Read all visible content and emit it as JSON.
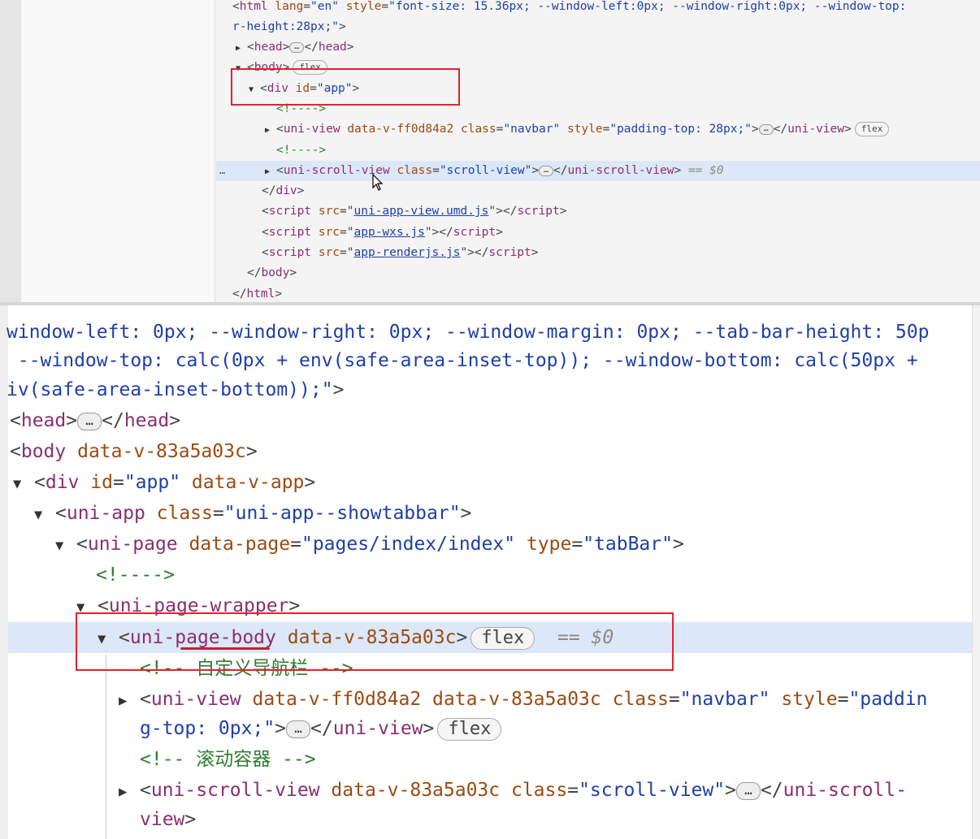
{
  "top_panel": {
    "lines": [
      {
        "parts": [
          [
            "p",
            "<"
          ],
          [
            "t",
            "html "
          ],
          [
            "a",
            "lang"
          ],
          [
            "p",
            "="
          ],
          [
            "v",
            "\"en\""
          ],
          [
            "p",
            " "
          ],
          [
            "a",
            "style"
          ],
          [
            "p",
            "="
          ],
          [
            "v",
            "\"font-size: 15.36px; --window-left:0px; --window-right:0px; --window-top:"
          ]
        ]
      },
      {
        "parts": [
          [
            "v",
            "r-height:28px;\""
          ],
          [
            "p",
            ">"
          ]
        ]
      },
      {
        "tri": "▶",
        "parts": [
          [
            "p",
            "<"
          ],
          [
            "t",
            "head"
          ],
          [
            "p",
            ">"
          ],
          [
            "d",
            "…"
          ],
          [
            "p",
            "</"
          ],
          [
            "t",
            "head"
          ],
          [
            "p",
            ">"
          ]
        ]
      },
      {
        "tri": "▼",
        "parts": [
          [
            "p",
            "<"
          ],
          [
            "t",
            "body"
          ],
          [
            "p",
            ">"
          ],
          [
            "b",
            "flex"
          ]
        ]
      },
      {
        "tri": "▼",
        "parts": [
          [
            "p",
            "<"
          ],
          [
            "t",
            "div "
          ],
          [
            "a",
            "id"
          ],
          [
            "p",
            "="
          ],
          [
            "v",
            "\"app\""
          ],
          [
            "p",
            ">"
          ]
        ]
      },
      {
        "parts": [
          [
            "c",
            "<!---->"
          ]
        ]
      },
      {
        "tri": "▶",
        "parts": [
          [
            "p",
            "<"
          ],
          [
            "t",
            "uni-view "
          ],
          [
            "a",
            "data-v-ff0d84a2 class"
          ],
          [
            "p",
            "="
          ],
          [
            "v",
            "\"navbar\""
          ],
          [
            "p",
            " "
          ],
          [
            "a",
            "style"
          ],
          [
            "p",
            "="
          ],
          [
            "v",
            "\"padding-top: 28px;\""
          ],
          [
            "p",
            ">"
          ],
          [
            "d",
            "…"
          ],
          [
            "p",
            "</"
          ],
          [
            "t",
            "uni-view"
          ],
          [
            "p",
            ">"
          ],
          [
            "b",
            "flex"
          ]
        ]
      },
      {
        "parts": [
          [
            "c",
            "<!---->"
          ]
        ]
      },
      {
        "tri": "▶",
        "parts": [
          [
            "p",
            "<"
          ],
          [
            "t",
            "uni-scroll-view "
          ],
          [
            "a",
            "class"
          ],
          [
            "p",
            "="
          ],
          [
            "v",
            "\"scroll-view\""
          ],
          [
            "p",
            ">"
          ],
          [
            "d",
            "…"
          ],
          [
            "p",
            "</"
          ],
          [
            "t",
            "uni-scroll-view"
          ],
          [
            "p",
            "> "
          ],
          [
            "e",
            "== $0"
          ]
        ]
      },
      {
        "parts": [
          [
            "p",
            "</"
          ],
          [
            "t",
            "div"
          ],
          [
            "p",
            ">"
          ]
        ]
      },
      {
        "parts": [
          [
            "p",
            "<"
          ],
          [
            "t",
            "script "
          ],
          [
            "a",
            "src"
          ],
          [
            "p",
            "=\""
          ],
          [
            "l",
            "uni-app-view.umd.js"
          ],
          [
            "p",
            "\"></"
          ],
          [
            "t",
            "script"
          ],
          [
            "p",
            ">"
          ]
        ]
      },
      {
        "parts": [
          [
            "p",
            "<"
          ],
          [
            "t",
            "script "
          ],
          [
            "a",
            "src"
          ],
          [
            "p",
            "=\""
          ],
          [
            "l",
            "app-wxs.js"
          ],
          [
            "p",
            "\"></"
          ],
          [
            "t",
            "script"
          ],
          [
            "p",
            ">"
          ]
        ]
      },
      {
        "parts": [
          [
            "p",
            "<"
          ],
          [
            "t",
            "script "
          ],
          [
            "a",
            "src"
          ],
          [
            "p",
            "=\""
          ],
          [
            "l",
            "app-renderjs.js"
          ],
          [
            "p",
            "\"></"
          ],
          [
            "t",
            "script"
          ],
          [
            "p",
            ">"
          ]
        ]
      },
      {
        "parts": [
          [
            "p",
            "</"
          ],
          [
            "t",
            "body"
          ],
          [
            "p",
            ">"
          ]
        ]
      },
      {
        "parts": [
          [
            "p",
            "</"
          ],
          [
            "t",
            "html"
          ],
          [
            "p",
            ">"
          ]
        ]
      }
    ]
  },
  "bottom_panel": {
    "lines": [
      {
        "parts": [
          [
            "v",
            "window-left: 0px; --window-right: 0px; --window-margin: 0px; --tab-bar-height: 50p"
          ]
        ]
      },
      {
        "parts": [
          [
            "v",
            " --window-top: calc(0px + env(safe-area-inset-top)); --window-bottom: calc(50px +"
          ]
        ]
      },
      {
        "parts": [
          [
            "v",
            "iv(safe-area-inset-bottom));\""
          ],
          [
            "p",
            ">"
          ]
        ]
      },
      {
        "parts": [
          [
            "p",
            "<"
          ],
          [
            "t",
            "head"
          ],
          [
            "p",
            ">"
          ],
          [
            "d",
            "…"
          ],
          [
            "p",
            "</"
          ],
          [
            "t",
            "head"
          ],
          [
            "p",
            ">"
          ]
        ]
      },
      {
        "parts": [
          [
            "p",
            "<"
          ],
          [
            "t",
            "body "
          ],
          [
            "a",
            "data-v-83a5a03c"
          ],
          [
            "p",
            ">"
          ]
        ]
      },
      {
        "tri": "▼",
        "parts": [
          [
            "p",
            "<"
          ],
          [
            "t",
            "div "
          ],
          [
            "a",
            "id"
          ],
          [
            "p",
            "="
          ],
          [
            "v",
            "\"app\""
          ],
          [
            "p",
            " "
          ],
          [
            "a",
            "data-v-app"
          ],
          [
            "p",
            ">"
          ]
        ]
      },
      {
        "tri": "▼",
        "parts": [
          [
            "p",
            "<"
          ],
          [
            "t",
            "uni-app "
          ],
          [
            "a",
            "class"
          ],
          [
            "p",
            "="
          ],
          [
            "v",
            "\"uni-app--showtabbar\""
          ],
          [
            "p",
            ">"
          ]
        ]
      },
      {
        "tri": "▼",
        "parts": [
          [
            "p",
            "<"
          ],
          [
            "t",
            "uni-page "
          ],
          [
            "a",
            "data-page"
          ],
          [
            "p",
            "="
          ],
          [
            "v",
            "\"pages/index/index\""
          ],
          [
            "p",
            " "
          ],
          [
            "a",
            "type"
          ],
          [
            "p",
            "="
          ],
          [
            "v",
            "\"tabBar\""
          ],
          [
            "p",
            ">"
          ]
        ]
      },
      {
        "parts": [
          [
            "c",
            "<!---->"
          ]
        ]
      },
      {
        "tri": "▼",
        "parts": [
          [
            "p",
            "<"
          ],
          [
            "t",
            "uni-page-wrapper"
          ],
          [
            "p",
            ">"
          ]
        ]
      },
      {
        "tri": "▼",
        "parts": [
          [
            "p",
            "<"
          ],
          [
            "t",
            "uni-page-body "
          ],
          [
            "a",
            "data-v-83a5a03c"
          ],
          [
            "p",
            ">"
          ],
          [
            "b",
            "flex"
          ],
          [
            "p",
            "  "
          ],
          [
            "e",
            "== $0"
          ]
        ]
      },
      {
        "parts": [
          [
            "c",
            "<!-- 自定义导航栏 -->"
          ]
        ]
      },
      {
        "tri": "▶",
        "parts": [
          [
            "p",
            "<"
          ],
          [
            "t",
            "uni-view "
          ],
          [
            "a",
            "data-v-ff0d84a2 data-v-83a5a03c class"
          ],
          [
            "p",
            "="
          ],
          [
            "v",
            "\"navbar\""
          ],
          [
            "p",
            " "
          ],
          [
            "a",
            "style"
          ],
          [
            "p",
            "="
          ],
          [
            "v",
            "\"paddin"
          ]
        ]
      },
      {
        "parts": [
          [
            "v",
            "g-top: 0px;\""
          ],
          [
            "p",
            ">"
          ],
          [
            "d",
            "…"
          ],
          [
            "p",
            "</"
          ],
          [
            "t",
            "uni-view"
          ],
          [
            "p",
            ">"
          ],
          [
            "b",
            "flex"
          ]
        ]
      },
      {
        "parts": [
          [
            "c",
            "<!-- 滚动容器 -->"
          ]
        ]
      },
      {
        "tri": "▶",
        "parts": [
          [
            "p",
            "<"
          ],
          [
            "t",
            "uni-scroll-view "
          ],
          [
            "a",
            "data-v-83a5a03c class"
          ],
          [
            "p",
            "="
          ],
          [
            "v",
            "\"scroll-view\""
          ],
          [
            "p",
            ">"
          ],
          [
            "d",
            "…"
          ],
          [
            "p",
            "</"
          ],
          [
            "t",
            "uni-scroll-"
          ]
        ]
      },
      {
        "parts": [
          [
            "t",
            "view"
          ],
          [
            "p",
            ">"
          ]
        ]
      }
    ]
  },
  "gutter_marker": "…"
}
